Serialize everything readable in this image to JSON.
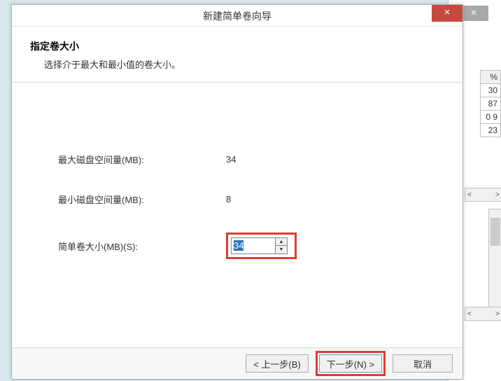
{
  "background": {
    "close_glyph": "×",
    "percent_header": "%",
    "rows": [
      "30",
      "87",
      "0 9",
      "23"
    ],
    "scroll_left": "<",
    "scroll_right": ">"
  },
  "wizard": {
    "title": "新建简单卷向导",
    "close_glyph": "×",
    "heading": "指定卷大小",
    "subheading": "选择介于最大和最小值的卷大小。",
    "max_label": "最大磁盘空间量(MB):",
    "max_value": "34",
    "min_label": "最小磁盘空间量(MB):",
    "min_value": "8",
    "size_label": "简单卷大小(MB)(S):",
    "size_value": "34",
    "spin_up": "▲",
    "spin_down": "▼",
    "back": "< 上一步(B)",
    "next": "下一步(N) >",
    "cancel": "取消"
  }
}
